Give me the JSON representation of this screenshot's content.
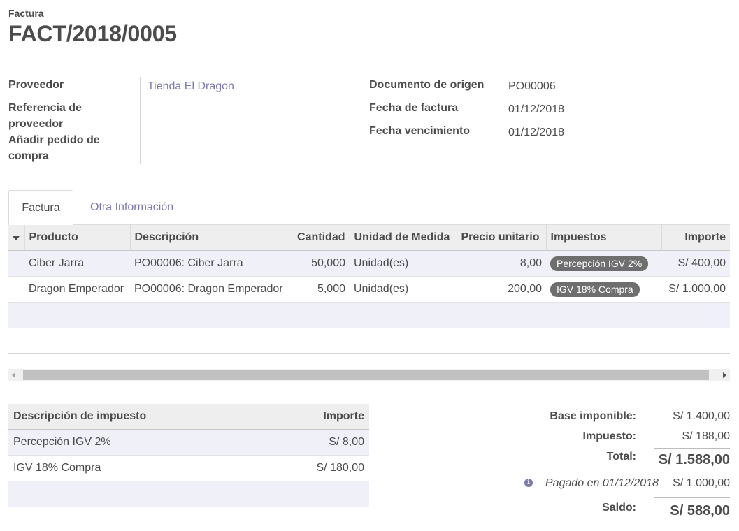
{
  "header": {
    "doc_type": "Factura",
    "doc_number": "FACT/2018/0005"
  },
  "left_fields": {
    "supplier_label": "Proveedor",
    "supplier_value": "Tienda El Dragon",
    "vendor_ref_label_1": "Referencia de",
    "vendor_ref_label_2": "proveedor",
    "add_po_label_1": "Añadir pedido de",
    "add_po_label_2": "compra"
  },
  "right_fields": {
    "origin_label": "Documento de origen",
    "origin_value": "PO00006",
    "invoice_date_label": "Fecha de factura",
    "invoice_date_value": "01/12/2018",
    "due_date_label": "Fecha vencimiento",
    "due_date_value": "01/12/2018"
  },
  "tabs": [
    {
      "label": "Factura"
    },
    {
      "label": "Otra Información"
    }
  ],
  "lines_table": {
    "headers": [
      "Producto",
      "Descripción",
      "Cantidad",
      "Unidad de Medida",
      "Precio unitario",
      "Impuestos",
      "Importe"
    ],
    "rows": [
      {
        "product": "Ciber Jarra",
        "description": "PO00006: Ciber Jarra",
        "qty": "50,000",
        "uom": "Unidad(es)",
        "price": "8,00",
        "tax": "Percepción IGV 2%",
        "amount": "S/ 400,00"
      },
      {
        "product": "Dragon Emperador",
        "description": "PO00006: Dragon Emperador",
        "qty": "5,000",
        "uom": "Unidad(es)",
        "price": "200,00",
        "tax": "IGV 18% Compra",
        "amount": "S/ 1.000,00"
      }
    ]
  },
  "tax_table": {
    "headers": [
      "Descripción de impuesto",
      "Importe"
    ],
    "rows": [
      {
        "description": "Percepción IGV 2%",
        "amount": "S/ 8,00"
      },
      {
        "description": "IGV 18% Compra",
        "amount": "S/ 180,00"
      }
    ]
  },
  "totals": {
    "base_label": "Base imponible:",
    "base_value": "S/ 1.400,00",
    "tax_label": "Impuesto:",
    "tax_value": "S/ 188,00",
    "total_label": "Total:",
    "total_value": "S/ 1.588,00",
    "payment_label": "Pagado en 01/12/2018",
    "payment_value": "S/ 1.000,00",
    "balance_label": "Saldo:",
    "balance_value": "S/ 588,00"
  },
  "colors": {
    "link": "#7c7bad",
    "badge": "#6e6e6e",
    "odd_row": "#f0f0f8",
    "header_bg": "#eeeeee"
  },
  "icons": {
    "info": "info-circle-icon",
    "sort": "caret-down-icon",
    "scroll_left": "scroll-left-arrow-icon",
    "scroll_right": "scroll-right-arrow-icon"
  }
}
